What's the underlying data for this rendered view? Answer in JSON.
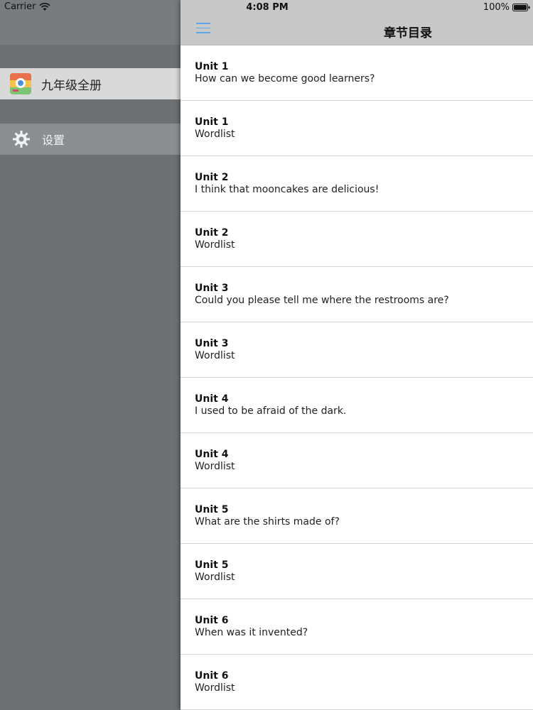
{
  "status_bar": {
    "carrier": "Carrier",
    "time": "4:08 PM",
    "battery": "100%"
  },
  "drawer": {
    "book_label": "九年级全册",
    "settings_label": "设置"
  },
  "navbar": {
    "title": "章节目录",
    "menu_icon": "hamburger-icon",
    "accent_color": "#5aa6e8"
  },
  "chapters": [
    {
      "unit": "Unit 1",
      "title": "How can we become good learners?"
    },
    {
      "unit": "Unit 1",
      "title": "Wordlist"
    },
    {
      "unit": "Unit 2",
      "title": "I think that mooncakes are delicious!"
    },
    {
      "unit": "Unit 2",
      "title": "Wordlist"
    },
    {
      "unit": "Unit 3",
      "title": "Could you please tell me where the restrooms are?"
    },
    {
      "unit": "Unit 3",
      "title": "Wordlist"
    },
    {
      "unit": "Unit 4",
      "title": "I used to be afraid of the dark."
    },
    {
      "unit": "Unit 4",
      "title": "Wordlist"
    },
    {
      "unit": "Unit 5",
      "title": "What are the shirts made of?"
    },
    {
      "unit": "Unit 5",
      "title": "Wordlist"
    },
    {
      "unit": "Unit 6",
      "title": "When was it invented?"
    },
    {
      "unit": "Unit 6",
      "title": "Wordlist"
    }
  ]
}
